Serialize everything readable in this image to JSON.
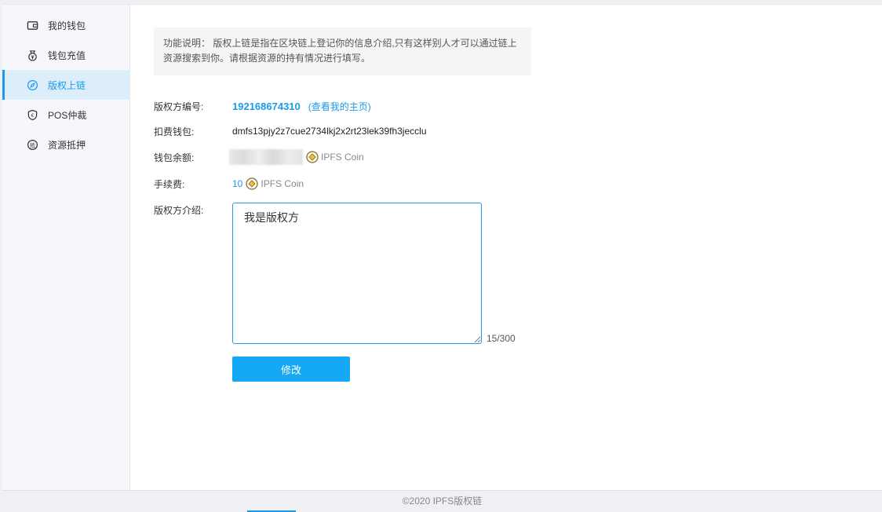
{
  "sidebar": {
    "items": [
      {
        "label": "我的钱包",
        "icon": "wallet-icon",
        "active": false
      },
      {
        "label": "钱包充值",
        "icon": "recharge-icon",
        "active": false
      },
      {
        "label": "版权上链",
        "icon": "compass-icon",
        "active": true
      },
      {
        "label": "POS仲裁",
        "icon": "arbitration-icon",
        "active": false
      },
      {
        "label": "资源抵押",
        "icon": "mortgage-icon",
        "active": false
      }
    ]
  },
  "notice": {
    "text": "功能说明： 版权上链是指在区块链上登记你的信息介绍,只有这样别人才可以通过链上资源搜索到你。请根据资源的持有情况进行填写。"
  },
  "form": {
    "copyright_id_label": "版权方编号:",
    "copyright_id": "192168674310",
    "homepage_link": "(查看我的主页)",
    "wallet_label": "扣费钱包:",
    "wallet_address": "dmfs13pjy2z7cue2734lkj2x2rt23lek39fh3jecclu",
    "balance_label": "钱包余额:",
    "balance_coin": "IPFS Coin",
    "fee_label": "手续费:",
    "fee_value": "10",
    "fee_coin": "IPFS Coin",
    "intro_label": "版权方介绍:",
    "intro_value": "我是版权方",
    "counter": "15/300",
    "submit_label": "修改"
  },
  "footer": {
    "text": "©2020 IPFS版权链"
  },
  "colors": {
    "accent": "#1a9be8",
    "button": "#14a8f5"
  }
}
